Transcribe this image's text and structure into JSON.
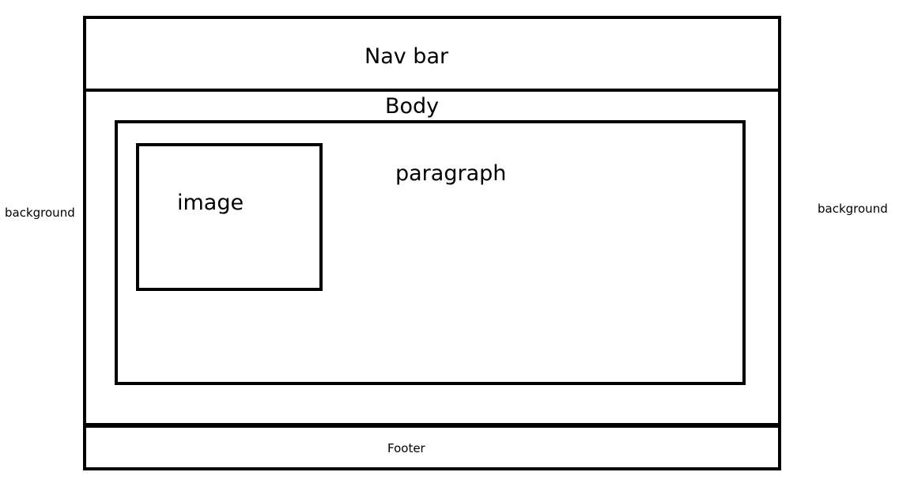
{
  "labels": {
    "nav_bar": "Nav bar",
    "body": "Body",
    "paragraph": "paragraph",
    "image": "image",
    "footer": "Footer",
    "background_left": "background",
    "background_right": "background"
  },
  "colors": {
    "stroke": "#000000",
    "background": "#ffffff"
  }
}
